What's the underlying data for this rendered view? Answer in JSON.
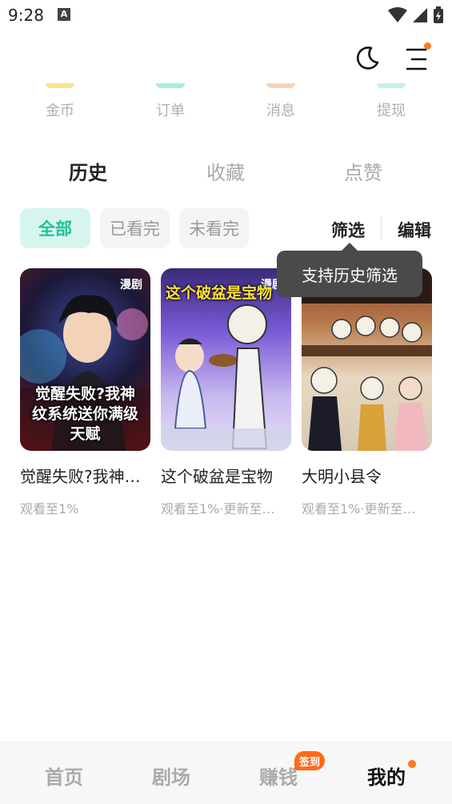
{
  "status": {
    "time": "9:28",
    "notification": "A"
  },
  "header": {
    "theme_icon": "moon-icon",
    "menu_icon": "menu-icon"
  },
  "stats": [
    {
      "label": "金币",
      "color": "#f7e58c"
    },
    {
      "label": "订单",
      "color": "#a9ecdd"
    },
    {
      "label": "消息",
      "color": "#f8d3b8"
    },
    {
      "label": "提现",
      "color": "#c6f1e4"
    }
  ],
  "tabs": [
    {
      "label": "历史",
      "active": true
    },
    {
      "label": "收藏",
      "active": false
    },
    {
      "label": "点赞",
      "active": false
    }
  ],
  "filters": {
    "chips": [
      {
        "label": "全部",
        "active": true
      },
      {
        "label": "已看完",
        "active": false
      },
      {
        "label": "未看完",
        "active": false
      }
    ],
    "filter_label": "筛选",
    "edit_label": "编辑",
    "tooltip": "支持历史筛选"
  },
  "cards": [
    {
      "title": "觉醒失败?我神…",
      "subtitle": "观看至1%",
      "tag": "漫剧",
      "cover_text": "觉醒失败?我神纹系统送你满级天赋"
    },
    {
      "title": "这个破盆是宝物",
      "subtitle": "观看至1%·更新至…",
      "tag": "漫剧",
      "cover_text": "这个破盆是宝物"
    },
    {
      "title": "大明小县令",
      "subtitle": "观看至1%·更新至…",
      "tag": "",
      "cover_text": ""
    }
  ],
  "bottom_nav": {
    "items": [
      {
        "label": "首页",
        "active": false
      },
      {
        "label": "剧场",
        "active": false
      },
      {
        "label": "赚钱",
        "active": false
      },
      {
        "label": "我的",
        "active": true
      }
    ],
    "badge": "签到"
  },
  "colors": {
    "accent": "#1fc29a",
    "orange": "#ff7a1a"
  }
}
